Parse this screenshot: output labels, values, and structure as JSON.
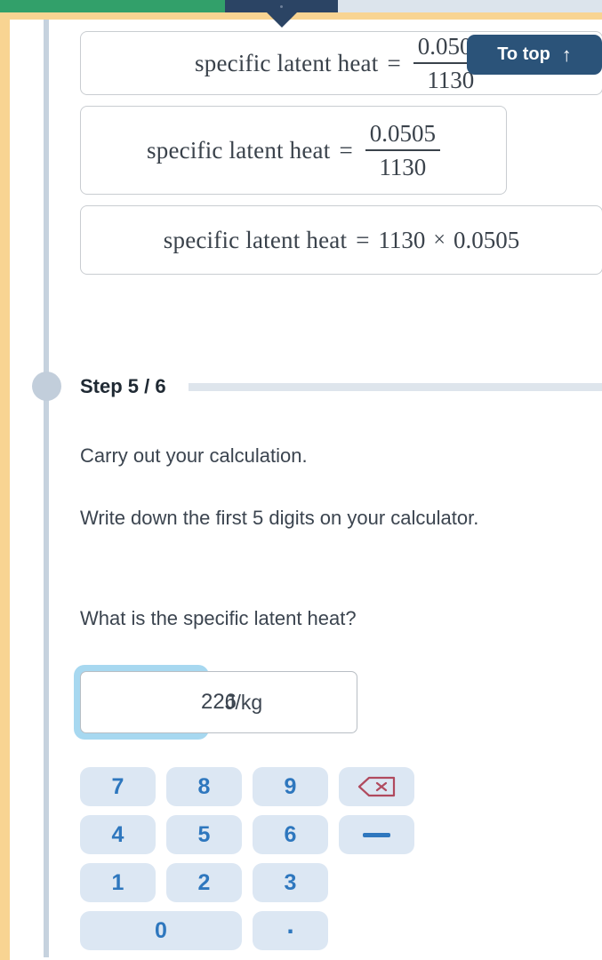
{
  "progress": {
    "completed_color": "#32A06A",
    "current_color": "#2B4464",
    "remaining_color": "#DCE4EC",
    "accent_color": "#F8D492"
  },
  "to_top": {
    "label": "To top",
    "arrow_icon": "↑",
    "background": "#2B5379"
  },
  "options": [
    {
      "lhs": "specific latent heat",
      "equals": "=",
      "numerator": "0.0505",
      "denominator": "1130",
      "form": "fraction-clipped"
    },
    {
      "lhs": "specific latent heat",
      "equals": "=",
      "numerator": "0.0505",
      "denominator": "1130",
      "form": "fraction"
    },
    {
      "lhs": "specific latent heat",
      "equals": "=",
      "left_operand": "1130",
      "operator": "×",
      "right_operand": "0.0505",
      "form": "product"
    }
  ],
  "step": {
    "title": "Step 5 / 6",
    "paragraphs": [
      "Carry out your calculation.",
      "Write down the first 5 digits on your calculator.",
      "What is the specific latent heat?"
    ]
  },
  "answer": {
    "value": "226",
    "placeholder": "",
    "unit": "J/kg",
    "focus_ring_color": "#A7D8F0"
  },
  "keypad": {
    "key_background": "#DCE7F3",
    "key_text_color": "#2E77BE",
    "backspace_icon_color": "#B04A5E",
    "rows": [
      [
        {
          "label": "7",
          "name": "key-7",
          "type": "digit"
        },
        {
          "label": "8",
          "name": "key-8",
          "type": "digit"
        },
        {
          "label": "9",
          "name": "key-9",
          "type": "digit"
        },
        {
          "label": "",
          "name": "key-backspace",
          "type": "backspace"
        }
      ],
      [
        {
          "label": "4",
          "name": "key-4",
          "type": "digit"
        },
        {
          "label": "5",
          "name": "key-5",
          "type": "digit"
        },
        {
          "label": "6",
          "name": "key-6",
          "type": "digit"
        },
        {
          "label": "",
          "name": "key-minus",
          "type": "minus"
        }
      ],
      [
        {
          "label": "1",
          "name": "key-1",
          "type": "digit"
        },
        {
          "label": "2",
          "name": "key-2",
          "type": "digit"
        },
        {
          "label": "3",
          "name": "key-3",
          "type": "digit"
        }
      ],
      [
        {
          "label": "0",
          "name": "key-0",
          "type": "digit-wide"
        },
        {
          "label": ".",
          "name": "key-decimal",
          "type": "decimal"
        }
      ]
    ]
  }
}
